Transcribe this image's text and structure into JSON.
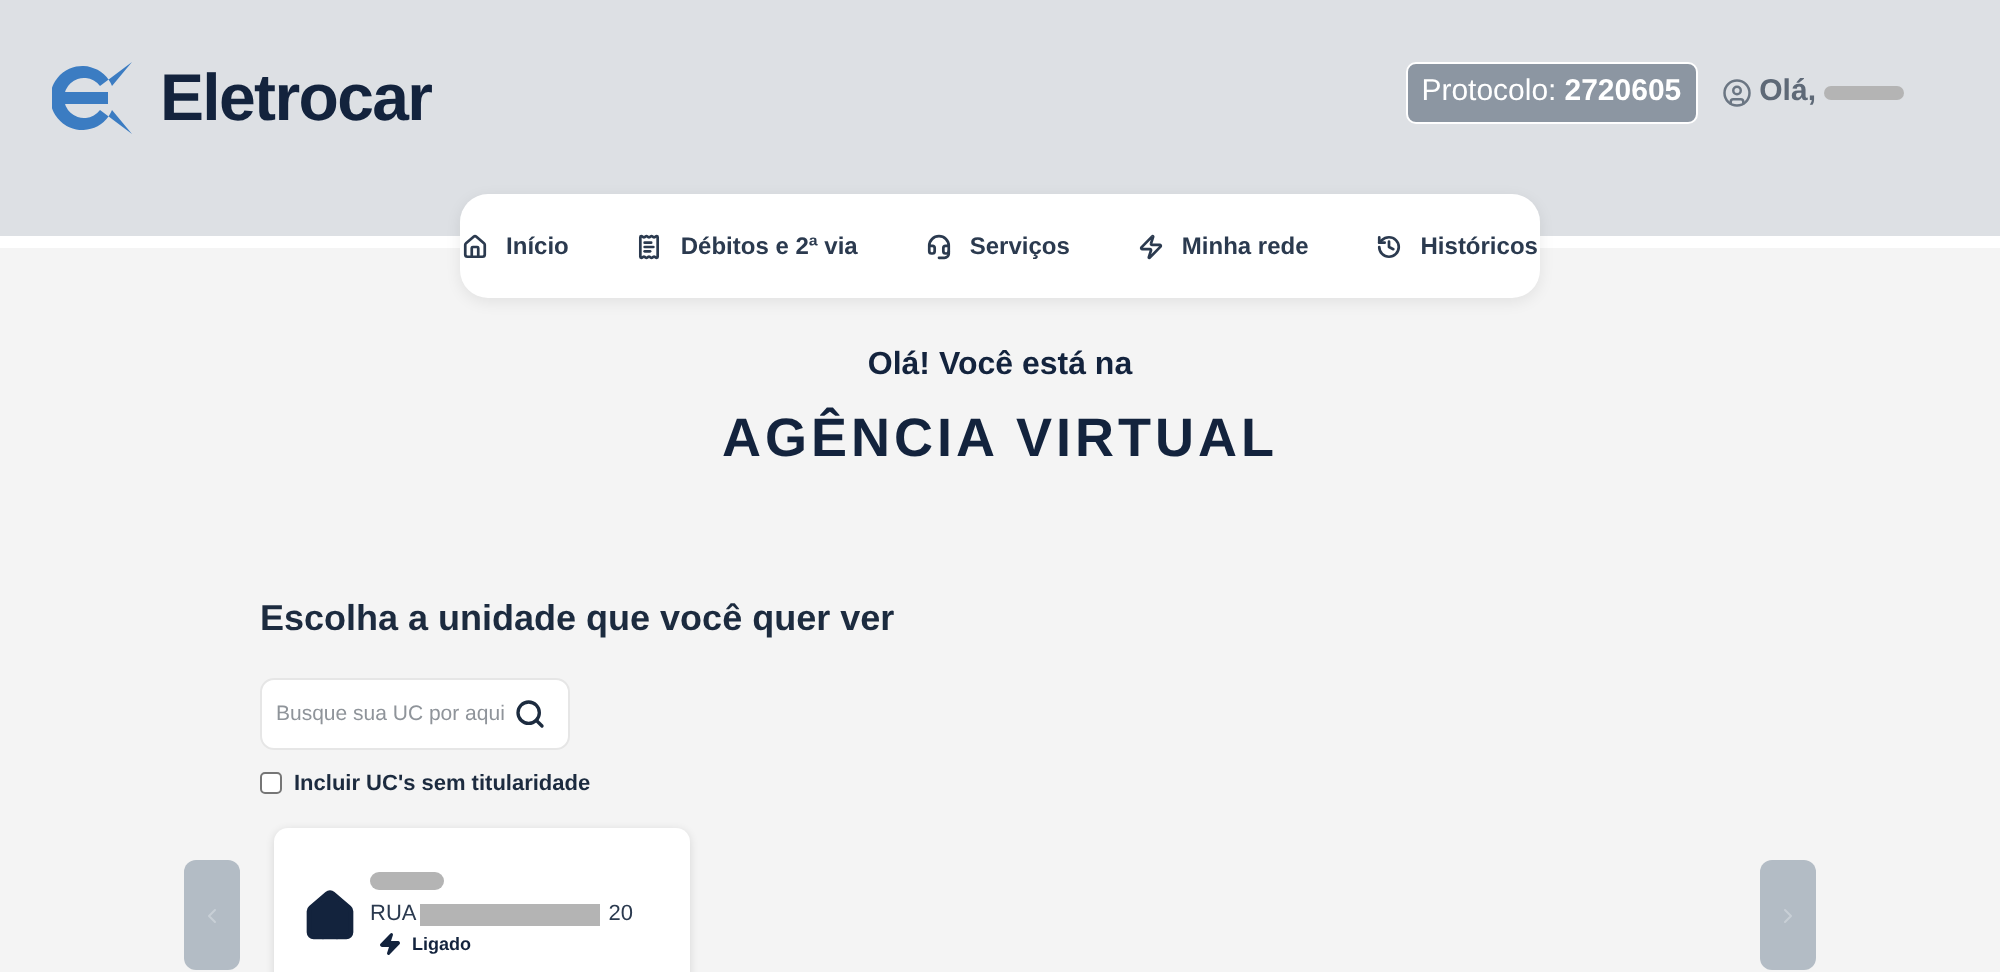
{
  "header": {
    "brand": "Eletrocar",
    "protocol_label": "Protocolo:",
    "protocol_number": "2720605",
    "greeting": "Olá,"
  },
  "nav": [
    {
      "label": "Início"
    },
    {
      "label": "Débitos e 2ª via"
    },
    {
      "label": "Serviços"
    },
    {
      "label": "Minha rede"
    },
    {
      "label": "Históricos"
    }
  ],
  "welcome": {
    "line": "Olá! Você está na",
    "title": "AGÊNCIA VIRTUAL"
  },
  "units": {
    "heading": "Escolha a unidade que você quer ver",
    "search": {
      "placeholder": "Busque sua UC por aqui"
    },
    "include_checkbox": {
      "label": "Incluir UC's sem titularidade",
      "checked": false
    },
    "cards": [
      {
        "street": "RUA",
        "number": "20",
        "status": "Ligado"
      }
    ]
  }
}
